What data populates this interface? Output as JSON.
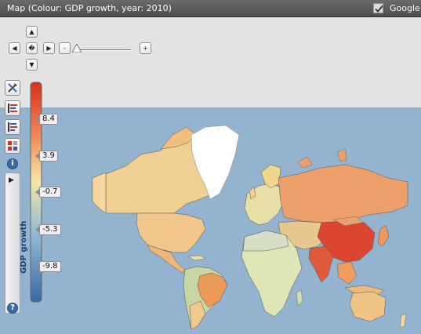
{
  "window": {
    "title": "Map (Colour: GDP growth, year: 2010)",
    "google_label": "Google",
    "google_checked": true
  },
  "navigation": {
    "up": "▲",
    "down": "▼",
    "left": "◀",
    "right": "▶",
    "center": "�",
    "zoom_out": "-",
    "zoom_in": "+"
  },
  "tools": {
    "settings_icon": "wrench-screwdriver-icon",
    "legend_icon_1": "list-chart-icon",
    "legend_icon_2": "list-chart-alt-icon",
    "color_table_icon": "color-table-icon",
    "info": "i",
    "help": "?"
  },
  "side_panel": {
    "toggle_arrow": "▶",
    "label": "GDP growth"
  },
  "color_scale": {
    "variable": "GDP growth",
    "ticks": [
      "8.4",
      "3.9",
      "-0.7",
      "-5.3",
      "-9.8"
    ],
    "colors": {
      "high": "#d7301f",
      "upper": "#f08a5a",
      "mid": "#f3e8a8",
      "lower": "#8fb6d4",
      "low": "#3b69a6"
    }
  },
  "map": {
    "ocean_color": "#94b3cf",
    "land_neutral": "#e9e6d8",
    "greenland_color": "#ffffff"
  }
}
